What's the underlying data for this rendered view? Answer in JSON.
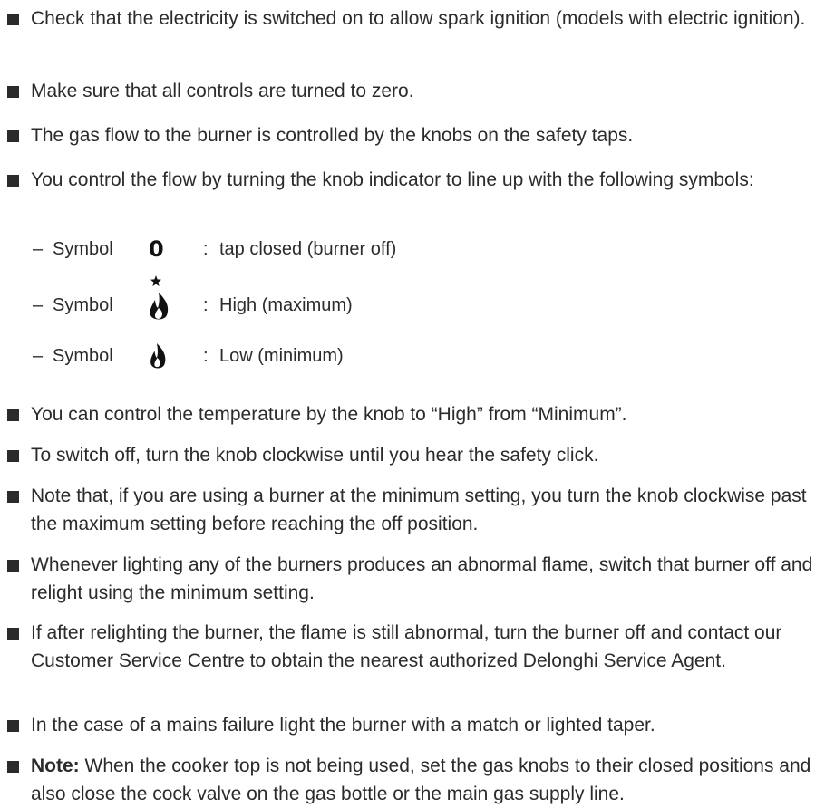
{
  "items": [
    "Check that the electricity is switched on to allow spark ignition (models with electric ignition).",
    "Make sure that all controls are turned to zero.",
    "The gas flow to the burner is controlled by the knobs on the safety taps.",
    "You control the flow by turning the knob indicator to line up with the following symbols:"
  ],
  "symbols": [
    {
      "dash": "–",
      "word": "Symbol",
      "icon": "zero-icon",
      "glyph": "0",
      "colon": ":",
      "desc": "tap closed (burner off)"
    },
    {
      "dash": "–",
      "word": "Symbol",
      "icon": "large-flame-star-icon",
      "colon": ":",
      "desc": "High (maximum)"
    },
    {
      "dash": "–",
      "word": "Symbol",
      "icon": "small-flame-icon",
      "colon": ":",
      "desc": "Low (minimum)"
    }
  ],
  "items2": [
    "You can control the temperature by the knob to “High” from “Minimum”.",
    "To switch off, turn the knob clockwise until you hear the safety click.",
    "Note that, if you are using a burner at the minimum setting, you turn the knob clockwise past the maximum setting before reaching the off position.",
    "Whenever lighting any of the burners produces an abnormal flame, switch that burner off and relight using the minimum setting.",
    "If after relighting the burner, the flame is still abnormal, turn the burner off and contact our Customer Service Centre to obtain the nearest authorized Delonghi Service Agent.",
    "In the case of a mains failure light the burner with a match or lighted taper."
  ],
  "note": {
    "label": "Note:",
    "text": " When  the cooker top is not being used, set the gas knobs to their closed positions and also close the cock valve on the gas bottle or the main gas supply line."
  }
}
